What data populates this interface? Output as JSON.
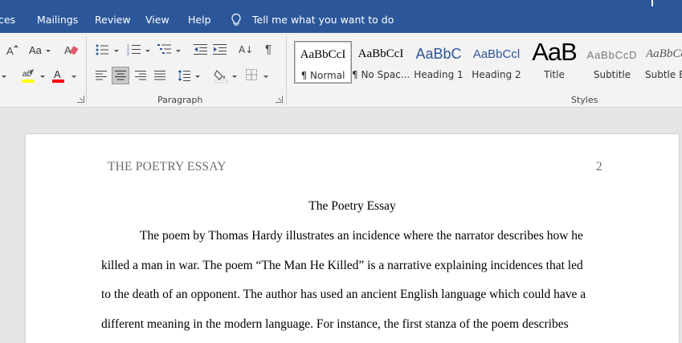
{
  "ribbon_tabs": {
    "references_partial": "ces",
    "mailings": "Mailings",
    "review": "Review",
    "view": "View",
    "help": "Help",
    "tell_me": "Tell me what you want to do"
  },
  "font_group": {
    "size_label": "A",
    "case_label": "Aa",
    "font_color_letter": "A",
    "highlight_letter": "ab"
  },
  "paragraph_group": {
    "label": "Paragraph",
    "show_marks": "¶"
  },
  "styles_group": {
    "label": "Styles",
    "items": [
      {
        "sample": "AaBbCcI",
        "name": "¶ Normal"
      },
      {
        "sample": "AaBbCcI",
        "name": "¶ No Spac..."
      },
      {
        "sample": "AaBbC",
        "name": "Heading 1"
      },
      {
        "sample": "AaBbCcl",
        "name": "Heading 2"
      },
      {
        "sample": "AaB",
        "name": "Title"
      },
      {
        "sample": "AaBbCcD",
        "name": "Subtitle"
      },
      {
        "sample": "AaBbCcI",
        "name": "Subtle Er"
      }
    ]
  },
  "colors": {
    "ribbon_blue": "#2b579a",
    "highlight_yellow": "#ffff00",
    "font_red": "#ff0000",
    "heading_blue": "#2f5496"
  },
  "document": {
    "header_title": "THE POETRY ESSAY",
    "page_number": "2",
    "title": "The Poetry Essay",
    "lines": [
      "The poem by Thomas Hardy illustrates an incidence where the narrator describes how he",
      "killed a man in war. The poem “The Man He Killed” is a narrative explaining incidences that led",
      "to the death of an opponent. The author has used an ancient English language which could have a",
      "different meaning in the modern language. For instance, the first stanza of the poem describes"
    ]
  }
}
